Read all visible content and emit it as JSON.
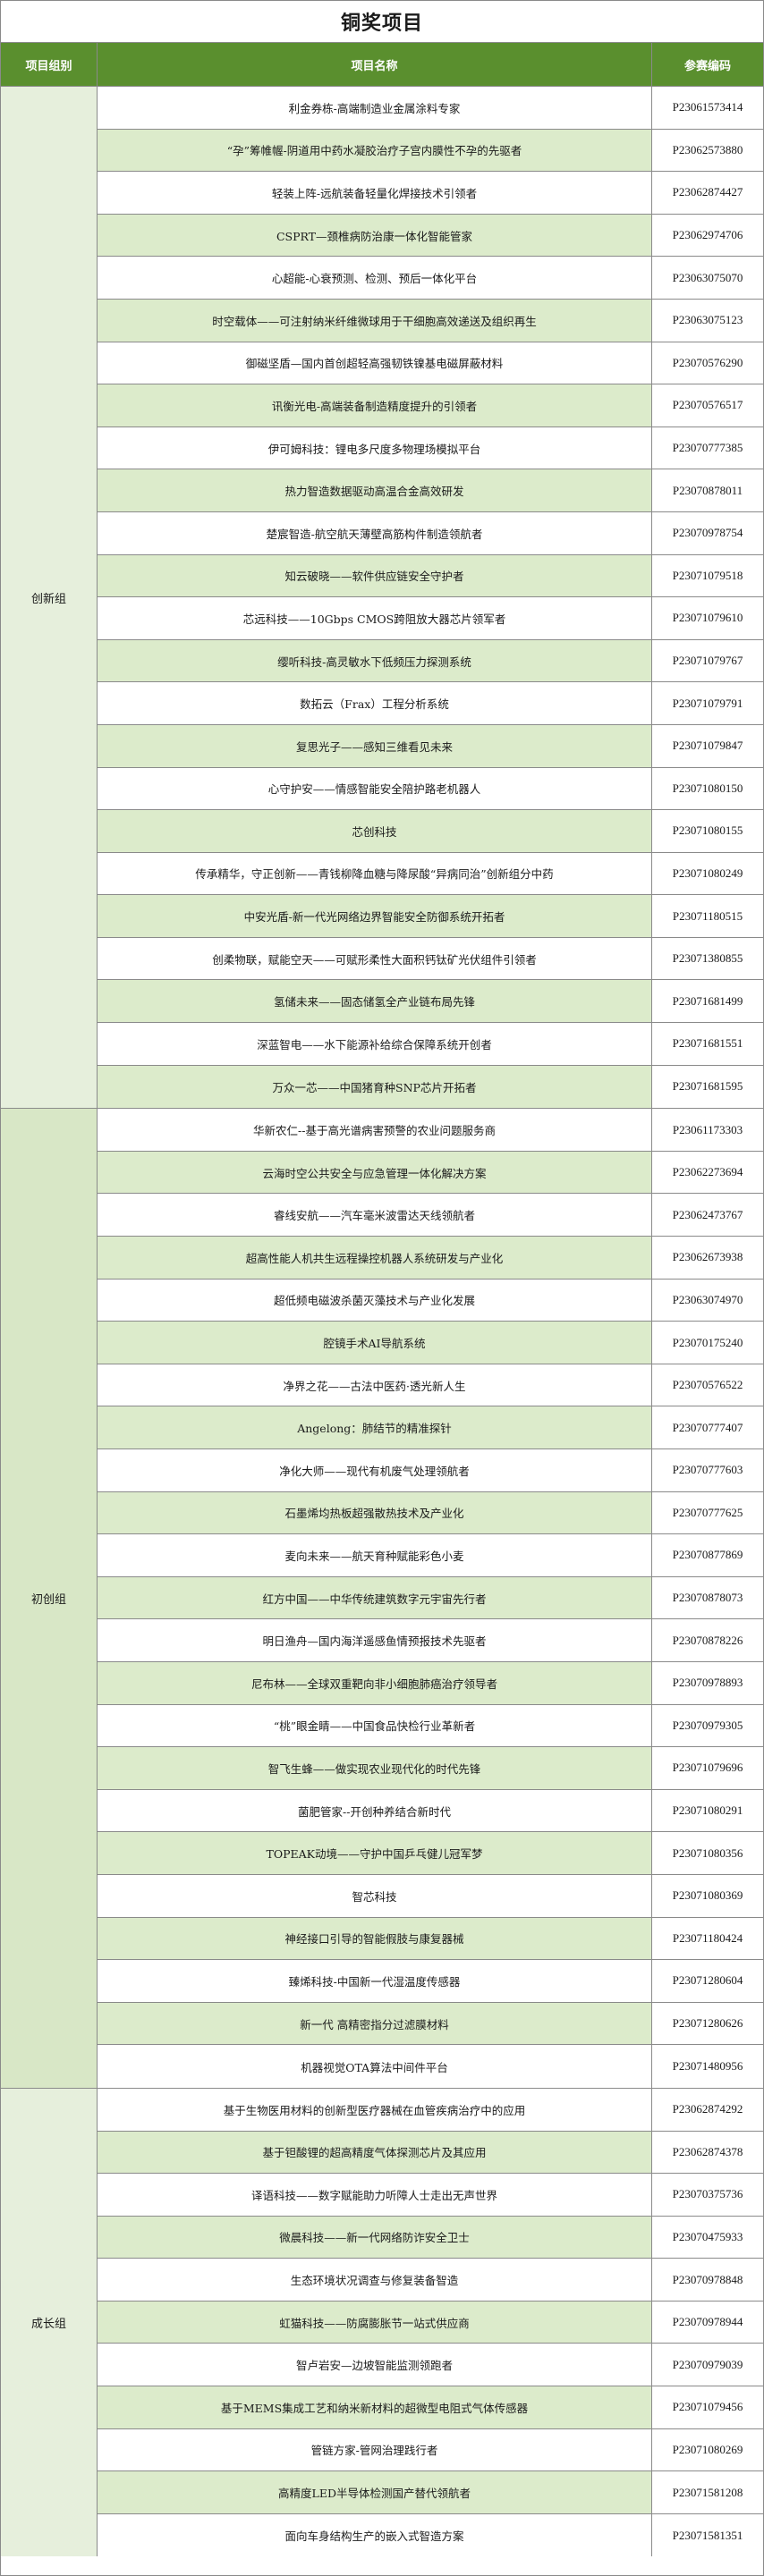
{
  "title": "铜奖项目",
  "headers": {
    "group": "项目组别",
    "name": "项目名称",
    "code": "参赛编码"
  },
  "groups": [
    {
      "name": "创新组",
      "rows": [
        {
          "name": "利金券栋-高端制造业金属涂料专家",
          "code": "P23061573414"
        },
        {
          "name": "“孕”筹帷幄-阴道用中药水凝胶治疗子宫内膜性不孕的先驱者",
          "code": "P23062573880"
        },
        {
          "name": "轻装上阵-远航装备轻量化焊接技术引领者",
          "code": "P23062874427"
        },
        {
          "name": "CSPRT—颈椎病防治康一体化智能管家",
          "code": "P23062974706"
        },
        {
          "name": "心超能-心衰预测、检测、预后一体化平台",
          "code": "P23063075070"
        },
        {
          "name": "时空载体——可注射纳米纤维微球用于干细胞高效递送及组织再生",
          "code": "P23063075123"
        },
        {
          "name": "御磁坚盾—国内首创超轻高强韧铁镍基电磁屏蔽材料",
          "code": "P23070576290"
        },
        {
          "name": "讯衡光电-高端装备制造精度提升的引领者",
          "code": "P23070576517"
        },
        {
          "name": "伊可姆科技：锂电多尺度多物理场模拟平台",
          "code": "P23070777385"
        },
        {
          "name": "热力智造数据驱动高温合金高效研发",
          "code": "P23070878011"
        },
        {
          "name": "楚宸智造-航空航天薄壁高筋构件制造领航者",
          "code": "P23070978754"
        },
        {
          "name": "知云破晓——软件供应链安全守护者",
          "code": "P23071079518"
        },
        {
          "name": "芯远科技——10Gbps CMOS跨阻放大器芯片领军者",
          "code": "P23071079610"
        },
        {
          "name": "缨听科技-高灵敏水下低频压力探测系统",
          "code": "P23071079767"
        },
        {
          "name": "数拓云（Frax）工程分析系统",
          "code": "P23071079791"
        },
        {
          "name": "复思光子——感知三维看见未来",
          "code": "P23071079847"
        },
        {
          "name": "心守护安——情感智能安全陪护路老机器人",
          "code": "P23071080150"
        },
        {
          "name": "芯创科技",
          "code": "P23071080155"
        },
        {
          "name": "传承精华，守正创新——青钱柳降血糖与降尿酸“异病同治”创新组分中药",
          "code": "P23071080249"
        },
        {
          "name": "中安光盾-新一代光网络边界智能安全防御系统开拓者",
          "code": "P23071180515"
        },
        {
          "name": "创柔物联，赋能空天——可赋形柔性大面积钙钛矿光伏组件引领者",
          "code": "P23071380855"
        },
        {
          "name": "氢储未来——固态储氢全产业链布局先锋",
          "code": "P23071681499"
        },
        {
          "name": "深蓝智电——水下能源补给综合保障系统开创者",
          "code": "P23071681551"
        },
        {
          "name": "万众一芯——中国猪育种SNP芯片开拓者",
          "code": "P23071681595"
        }
      ]
    },
    {
      "name": "初创组",
      "rows": [
        {
          "name": "华新农仁--基于高光谱病害预警的农业问题服务商",
          "code": "P23061173303"
        },
        {
          "name": "云海时空公共安全与应急管理一体化解决方案",
          "code": "P23062273694"
        },
        {
          "name": "睿线安航——汽车毫米波雷达天线领航者",
          "code": "P23062473767"
        },
        {
          "name": "超高性能人机共生远程操控机器人系统研发与产业化",
          "code": "P23062673938"
        },
        {
          "name": "超低频电磁波杀菌灭藻技术与产业化发展",
          "code": "P23063074970"
        },
        {
          "name": "腔镜手术AI导航系统",
          "code": "P23070175240"
        },
        {
          "name": "净界之花——古法中医药·透光新人生",
          "code": "P23070576522"
        },
        {
          "name": "Angelong：肺结节的精准探针",
          "code": "P23070777407"
        },
        {
          "name": "净化大师——现代有机废气处理领航者",
          "code": "P23070777603"
        },
        {
          "name": "石墨烯均热板超强散热技术及产业化",
          "code": "P23070777625"
        },
        {
          "name": "麦向未来——航天育种赋能彩色小麦",
          "code": "P23070877869"
        },
        {
          "name": "红方中国——中华传统建筑数字元宇宙先行者",
          "code": "P23070878073"
        },
        {
          "name": "明日渔舟—国内海洋遥感鱼情预报技术先驱者",
          "code": "P23070878226"
        },
        {
          "name": "尼布林——全球双重靶向非小细胞肺癌治疗领导者",
          "code": "P23070978893"
        },
        {
          "name": "“桃”眼金睛——中国食品快检行业革新者",
          "code": "P23070979305"
        },
        {
          "name": "智飞生蜂——做实现农业现代化的时代先锋",
          "code": "P23071079696"
        },
        {
          "name": "菌肥管家--开创种养结合新时代",
          "code": "P23071080291"
        },
        {
          "name": "TOPEAK动境——守护中国乒乓健儿冠军梦",
          "code": "P23071080356"
        },
        {
          "name": "智芯科技",
          "code": "P23071080369"
        },
        {
          "name": "神经接口引导的智能假肢与康复器械",
          "code": "P23071180424"
        },
        {
          "name": "臻烯科技-中国新一代湿温度传感器",
          "code": "P23071280604"
        },
        {
          "name": "新一代 高精密指分过滤膜材料",
          "code": "P23071280626"
        },
        {
          "name": "机器视觉OTA算法中间件平台",
          "code": "P23071480956"
        }
      ]
    },
    {
      "name": "成长组",
      "rows": [
        {
          "name": "基于生物医用材料的创新型医疗器械在血管疾病治疗中的应用",
          "code": "P23062874292"
        },
        {
          "name": "基于钽酸锂的超高精度气体探测芯片及其应用",
          "code": "P23062874378"
        },
        {
          "name": "译语科技——数字赋能助力听障人士走出无声世界",
          "code": "P23070375736"
        },
        {
          "name": "微晨科技——新一代网络防诈安全卫士",
          "code": "P23070475933"
        },
        {
          "name": "生态环境状况调查与修复装备智造",
          "code": "P23070978848"
        },
        {
          "name": "虹猫科技——防腐膨胀节一站式供应商",
          "code": "P23070978944"
        },
        {
          "name": "智卢岩安—边坡智能监测领跑者",
          "code": "P23070979039"
        },
        {
          "name": "基于MEMS集成工艺和纳米新材料的超微型电阻式气体传感器",
          "code": "P23071079456"
        },
        {
          "name": "管链方家-管网治理践行者",
          "code": "P23071080269"
        },
        {
          "name": "高精度LED半导体检测国产替代领航者",
          "code": "P23071581208"
        },
        {
          "name": "面向车身结构生产的嵌入式智造方案",
          "code": "P23071581351"
        }
      ]
    }
  ]
}
